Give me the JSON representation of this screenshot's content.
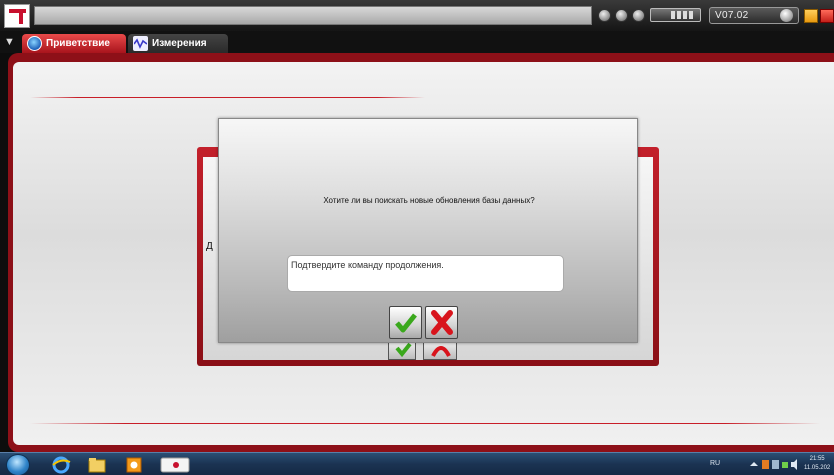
{
  "header": {
    "version": "V07.02"
  },
  "tabs": [
    {
      "label": "Приветствие",
      "active": true
    },
    {
      "label": "Измерения",
      "active": false
    }
  ],
  "underlying_dialog": {
    "partial_text": "Д"
  },
  "dialog": {
    "question": "Хотите ли вы поискать новые обновления базы данных?",
    "confirm_text": "Подтвердите команду продолжения."
  },
  "taskbar": {
    "language": "RU",
    "time": "21:55",
    "date": "11.05.202"
  },
  "colors": {
    "accent_red": "#c81e28",
    "tab_active": "#d83a3a",
    "ok_green": "#3aa81c",
    "cancel_red": "#d8141c"
  },
  "icons": {
    "ok": "check-icon",
    "cancel": "cross-icon"
  }
}
